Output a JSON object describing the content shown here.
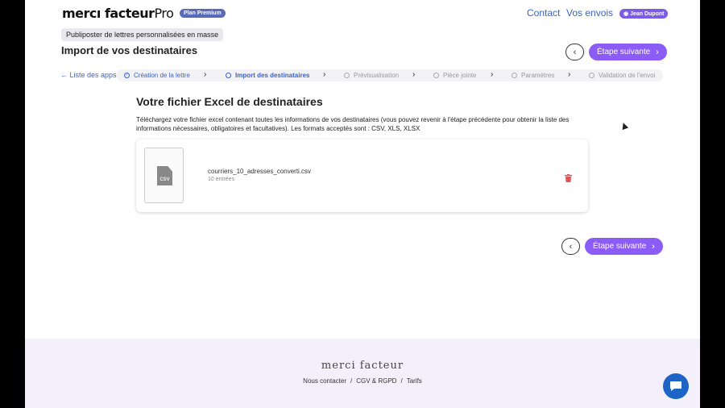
{
  "header": {
    "logo": "mercı facteur",
    "logo_suffix": "Pro",
    "plan_badge": "Plan Premium",
    "nav": [
      "Contact",
      "Vos envois"
    ],
    "user": "Jean Dupont"
  },
  "subtitle": "Publiposter de lettres personnalisées en masse",
  "page_title": "Import de vos destinataires",
  "next_label": "Étape suivante",
  "back_link": "Liste des apps",
  "steps": [
    {
      "label": "Création de la lettre",
      "state": "done"
    },
    {
      "label": "Import des destinataires",
      "state": "active"
    },
    {
      "label": "Prévisualisation",
      "state": "todo"
    },
    {
      "label": "Pièce jointe",
      "state": "todo"
    },
    {
      "label": "Paramètres",
      "state": "todo"
    },
    {
      "label": "Validation de l'envoi",
      "state": "todo"
    }
  ],
  "section_title": "Votre fichier Excel de destinataires",
  "description": "Téléchargez votre fichier excel contenant toutes les informations de vos destinataires (vous pouvez revenir à l'étape précédente pour obtenir la liste des informations nécessaires, obligatoires et facultatives). Les formats acceptés sont : CSV, XLS, XLSX",
  "file": {
    "type_label": "CSV",
    "name": "courriers_10_adresses_converti.csv",
    "count": "10 entrées"
  },
  "footer": {
    "logo": "merci facteur",
    "links": [
      "Nous contacter",
      "CGV & RGPD",
      "Tarifs"
    ]
  },
  "colors": {
    "accent": "#8b5cf6",
    "link": "#3b63c4",
    "danger": "#e05555",
    "chat": "#1e63c6"
  }
}
